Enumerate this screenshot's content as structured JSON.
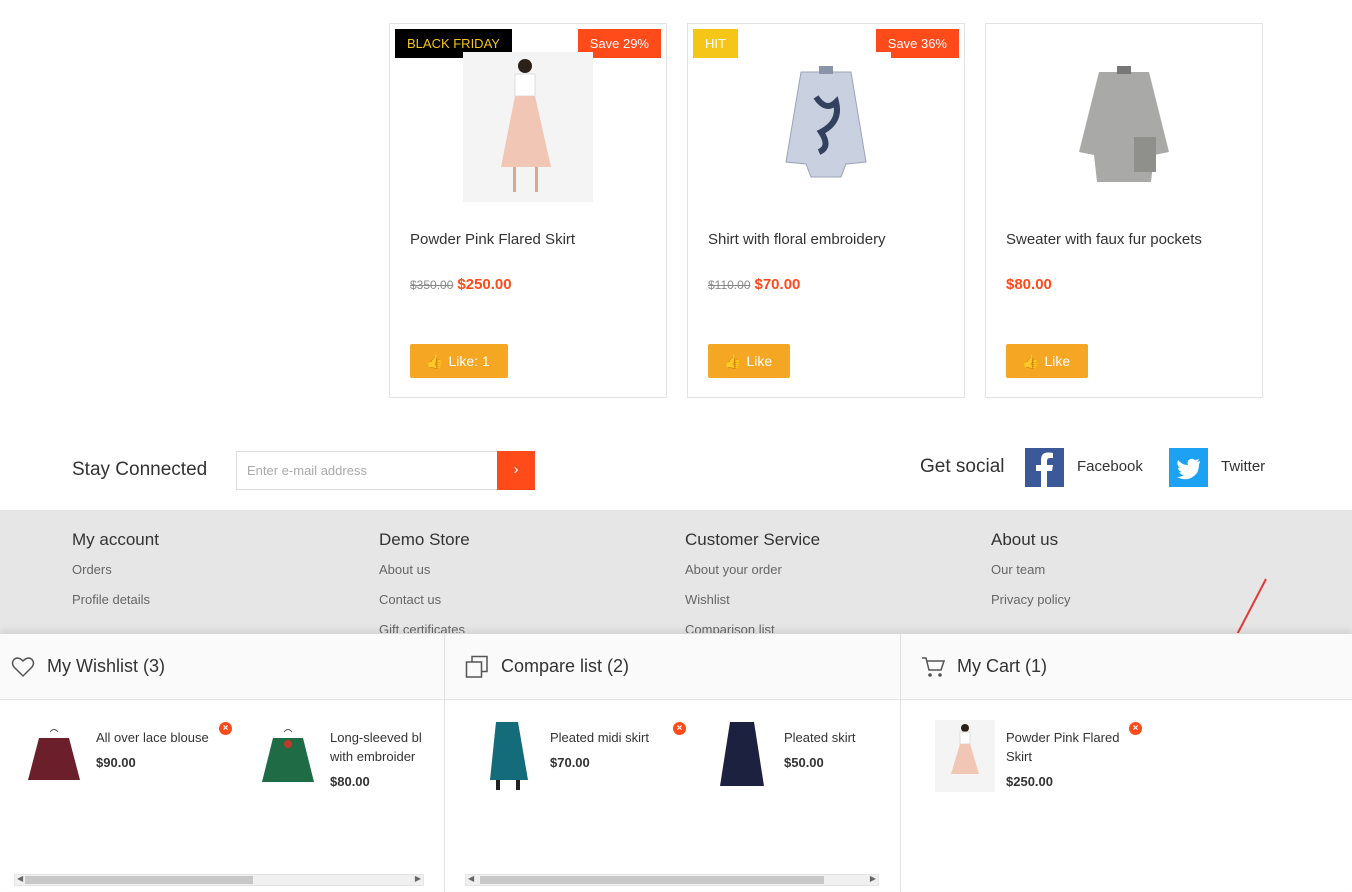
{
  "products": [
    {
      "badge_left": "BLACK FRIDAY",
      "badge_right": "Save 29%",
      "name": "Powder Pink Flared Skirt",
      "old_price": "$350.00",
      "price": "$250.00",
      "like": "Like: 1"
    },
    {
      "badge_left": "HIT",
      "badge_right": "Save 36%",
      "name": "Shirt with floral embroidery",
      "old_price": "$110.00",
      "price": "$70.00",
      "like": "Like"
    },
    {
      "badge_left": "",
      "badge_right": "",
      "name": "Sweater with faux fur pockets",
      "old_price": "",
      "price": "$80.00",
      "like": "Like"
    }
  ],
  "newsletter": {
    "title": "Stay Connected",
    "placeholder": "Enter e-mail address",
    "submit": "›"
  },
  "social": {
    "title": "Get social",
    "facebook": "Facebook",
    "twitter": "Twitter"
  },
  "footer": [
    {
      "title": "My account",
      "links": [
        "Orders",
        "Profile details"
      ]
    },
    {
      "title": "Demo Store",
      "links": [
        "About us",
        "Contact us",
        "Gift certificates"
      ]
    },
    {
      "title": "Customer Service",
      "links": [
        "About your order",
        "Wishlist",
        "Comparison list"
      ]
    },
    {
      "title": "About us",
      "links": [
        "Our team",
        "Privacy policy"
      ]
    }
  ],
  "wishlist": {
    "title": "My Wishlist (3)",
    "items": [
      {
        "name": "All over lace blouse",
        "price": "$90.00"
      },
      {
        "name": "Long-sleeved bl",
        "name2": "with embroider",
        "price": "$80.00"
      }
    ]
  },
  "compare": {
    "title": "Compare list (2)",
    "items": [
      {
        "name": "Pleated midi skirt",
        "price": "$70.00"
      },
      {
        "name": "Pleated skirt",
        "price": "$50.00"
      }
    ]
  },
  "cart": {
    "title": "My Cart (1)",
    "items": [
      {
        "name": "Powder Pink Flared",
        "name2": "Skirt",
        "price": "$250.00"
      }
    ]
  },
  "colors": {
    "accent": "#ff4a1a",
    "like": "#f5a623",
    "hit": "#f5c518",
    "black_friday_text": "#f5c518",
    "facebook": "#3b5998",
    "twitter": "#1da1f2"
  }
}
